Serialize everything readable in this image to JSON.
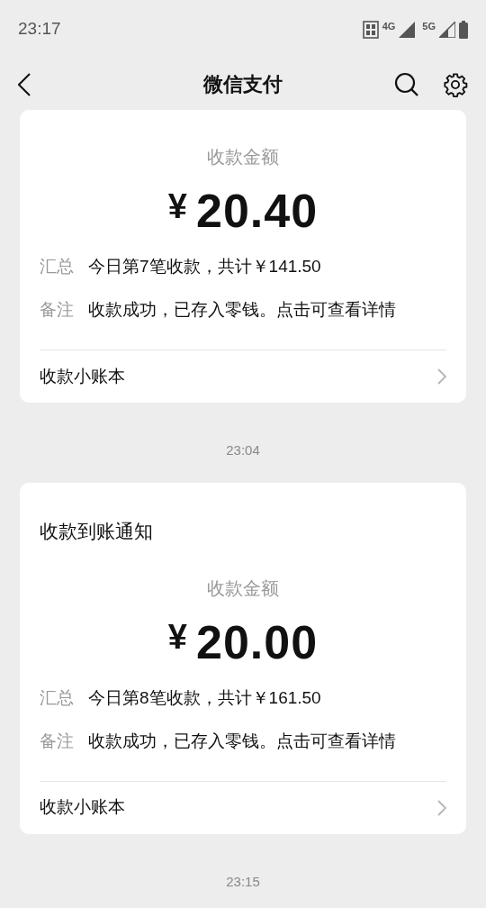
{
  "status_bar": {
    "time": "23:17",
    "network_1": "4G",
    "network_2": "5G"
  },
  "header": {
    "title": "微信支付"
  },
  "messages": [
    {
      "amount_label": "收款金额",
      "currency": "¥",
      "amount": "20.40",
      "summary_label": "汇总",
      "summary": "今日第7笔收款，共计￥141.50",
      "note_label": "备注",
      "note": "收款成功，已存入零钱。点击可查看详情",
      "link": "收款小账本"
    },
    {
      "time": "23:04",
      "title": "收款到账通知",
      "amount_label": "收款金额",
      "currency": "¥",
      "amount": "20.00",
      "summary_label": "汇总",
      "summary": "今日第8笔收款，共计￥161.50",
      "note_label": "备注",
      "note": "收款成功，已存入零钱。点击可查看详情",
      "link": "收款小账本"
    },
    {
      "time": "23:15"
    }
  ]
}
